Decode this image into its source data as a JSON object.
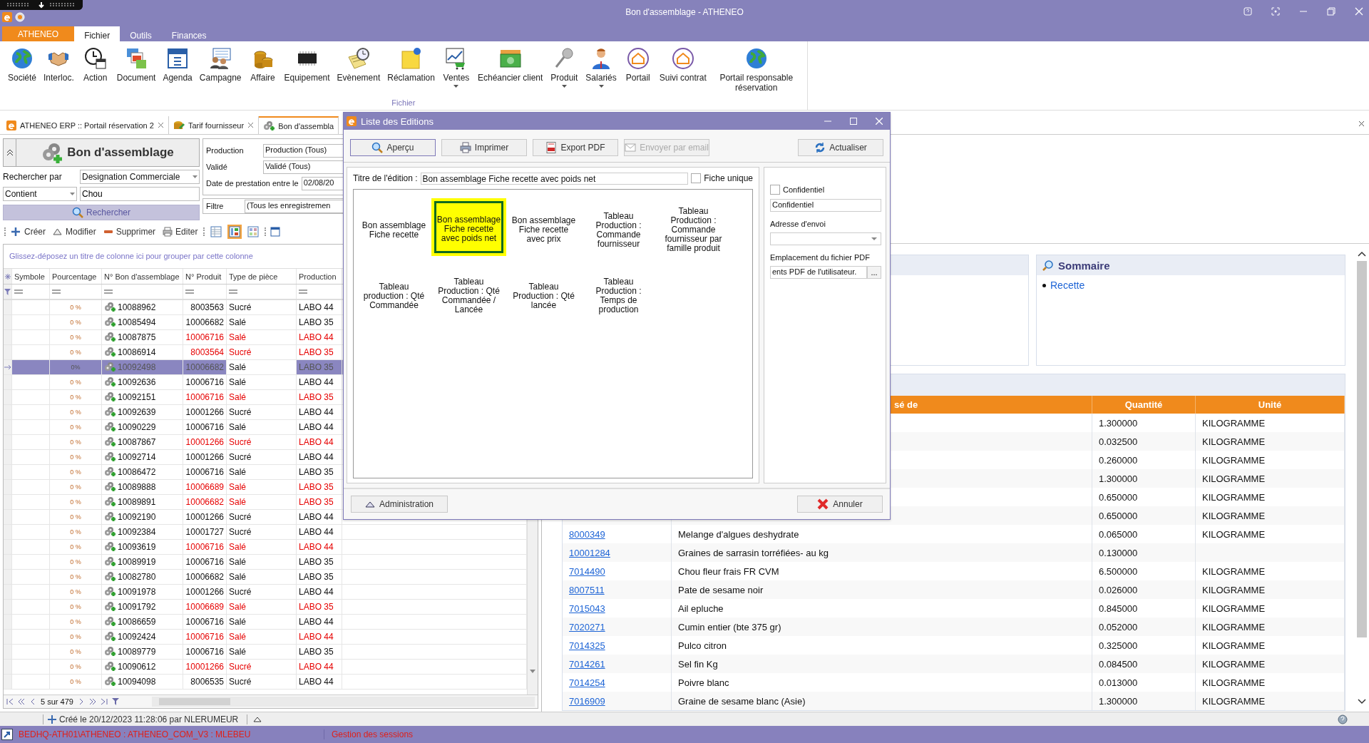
{
  "window": {
    "title": "Bon d'assemblage - ATHENEO"
  },
  "ribbon_tabs": [
    {
      "label": "ATHENEO",
      "kind": "app",
      "selected": false
    },
    {
      "label": "Fichier",
      "kind": "tab",
      "selected": true
    },
    {
      "label": "Outils",
      "kind": "tab",
      "selected": false
    },
    {
      "label": "Finances",
      "kind": "tab",
      "selected": false
    }
  ],
  "ribbon": {
    "group": "Fichier",
    "items": [
      {
        "label": "Société",
        "dropdown": false
      },
      {
        "label": "Interloc.",
        "dropdown": false
      },
      {
        "label": "Action",
        "dropdown": false
      },
      {
        "label": "Document",
        "dropdown": false
      },
      {
        "label": "Agenda",
        "dropdown": false
      },
      {
        "label": "Campagne",
        "dropdown": false
      },
      {
        "label": "Affaire",
        "dropdown": false
      },
      {
        "label": "Equipement",
        "dropdown": false
      },
      {
        "label": "Evènement",
        "dropdown": false
      },
      {
        "label": "Réclamation",
        "dropdown": false
      },
      {
        "label": "Ventes",
        "dropdown": true
      },
      {
        "label": "Echéancier client",
        "dropdown": false
      },
      {
        "label": "Produit",
        "dropdown": true
      },
      {
        "label": "Salariés",
        "dropdown": true
      },
      {
        "label": "Portail",
        "dropdown": false
      },
      {
        "label": "Suivi contrat",
        "dropdown": false
      },
      {
        "label": "Portail responsable réservation",
        "dropdown": false
      }
    ]
  },
  "document_tabs": [
    {
      "label": "ATHENEO ERP :: Portail réservation 2",
      "selected": false,
      "closable": true
    },
    {
      "label": "Tarif fournisseur",
      "selected": false,
      "closable": true
    },
    {
      "label": "Bon d'assembla",
      "selected": true,
      "closable": false
    }
  ],
  "search_panel": {
    "title": "Bon d'assemblage",
    "search_by_label": "Rechercher par",
    "search_by": "Designation Commerciale",
    "operator": "Contient",
    "query": "Chou",
    "button": "Rechercher"
  },
  "filter_panel": {
    "fields": [
      {
        "label": "Production",
        "value": "Production (Tous)"
      },
      {
        "label": "Validé",
        "value": "Validé (Tous)"
      },
      {
        "label": "Date de prestation entre le",
        "value": "02/08/20"
      }
    ],
    "filter_label": "Filtre",
    "filter_value": "(Tous les enregistremen"
  },
  "toolbar": {
    "actions": [
      "Créer",
      "Modifier",
      "Supprimer",
      "Editer"
    ],
    "views": [
      {
        "selected": false
      },
      {
        "selected": true
      },
      {
        "selected": false
      }
    ]
  },
  "grid": {
    "group_hint": "Glissez-déposez un titre de colonne ici pour grouper par cette colonne",
    "columns": [
      "Symbole",
      "Pourcentage",
      "N° Bon d'assemblage",
      "N° Produit",
      "Type de pièce",
      "Production"
    ],
    "rows": [
      {
        "percent": "0 %",
        "number": "10088962",
        "product": "8003563",
        "type": "Sucré",
        "production": "LABO 44",
        "flagged": false,
        "selected": false
      },
      {
        "percent": "0 %",
        "number": "10085494",
        "product": "10006682",
        "type": "Salé",
        "production": "LABO 35",
        "flagged": false,
        "selected": false
      },
      {
        "percent": "0 %",
        "number": "10087875",
        "product": "10006716",
        "type": "Salé",
        "production": "LABO 44",
        "flagged": true,
        "selected": false
      },
      {
        "percent": "0 %",
        "number": "10086914",
        "product": "8003564",
        "type": "Sucré",
        "production": "LABO 35",
        "flagged": true,
        "selected": false
      },
      {
        "percent": "0%",
        "number": "10092498",
        "product": "10006682",
        "type": "Salé",
        "production": "LABO 35",
        "flagged": false,
        "selected": true
      },
      {
        "percent": "0 %",
        "number": "10092636",
        "product": "10006716",
        "type": "Salé",
        "production": "LABO 44",
        "flagged": false,
        "selected": false
      },
      {
        "percent": "0 %",
        "number": "10092151",
        "product": "10006716",
        "type": "Salé",
        "production": "LABO 35",
        "flagged": true,
        "selected": false
      },
      {
        "percent": "0 %",
        "number": "10092639",
        "product": "10001266",
        "type": "Sucré",
        "production": "LABO 44",
        "flagged": false,
        "selected": false
      },
      {
        "percent": "0 %",
        "number": "10090229",
        "product": "10006716",
        "type": "Salé",
        "production": "LABO 44",
        "flagged": false,
        "selected": false
      },
      {
        "percent": "0 %",
        "number": "10087867",
        "product": "10001266",
        "type": "Sucré",
        "production": "LABO 44",
        "flagged": true,
        "selected": false
      },
      {
        "percent": "0 %",
        "number": "10092714",
        "product": "10001266",
        "type": "Sucré",
        "production": "LABO 44",
        "flagged": false,
        "selected": false
      },
      {
        "percent": "0 %",
        "number": "10086472",
        "product": "10006716",
        "type": "Salé",
        "production": "LABO 35",
        "flagged": false,
        "selected": false
      },
      {
        "percent": "0 %",
        "number": "10089888",
        "product": "10006689",
        "type": "Salé",
        "production": "LABO 35",
        "flagged": true,
        "selected": false
      },
      {
        "percent": "0 %",
        "number": "10089891",
        "product": "10006682",
        "type": "Salé",
        "production": "LABO 35",
        "flagged": true,
        "selected": false
      },
      {
        "percent": "0 %",
        "number": "10092190",
        "product": "10001266",
        "type": "Sucré",
        "production": "LABO 44",
        "flagged": false,
        "selected": false
      },
      {
        "percent": "0 %",
        "number": "10092384",
        "product": "10001727",
        "type": "Sucré",
        "production": "LABO 44",
        "flagged": false,
        "selected": false
      },
      {
        "percent": "0 %",
        "number": "10093619",
        "product": "10006716",
        "type": "Salé",
        "production": "LABO 44",
        "flagged": true,
        "selected": false
      },
      {
        "percent": "0 %",
        "number": "10089919",
        "product": "10006716",
        "type": "Salé",
        "production": "LABO 35",
        "flagged": false,
        "selected": false
      },
      {
        "percent": "0 %",
        "number": "10082780",
        "product": "10006682",
        "type": "Salé",
        "production": "LABO 35",
        "flagged": false,
        "selected": false
      },
      {
        "percent": "0 %",
        "number": "10091978",
        "product": "10001266",
        "type": "Sucré",
        "production": "LABO 44",
        "flagged": false,
        "selected": false
      },
      {
        "percent": "0 %",
        "number": "10091792",
        "product": "10006689",
        "type": "Salé",
        "production": "LABO 35",
        "flagged": true,
        "selected": false
      },
      {
        "percent": "0 %",
        "number": "10086659",
        "product": "10006716",
        "type": "Salé",
        "production": "LABO 44",
        "flagged": false,
        "selected": false
      },
      {
        "percent": "0 %",
        "number": "10092424",
        "product": "10006716",
        "type": "Salé",
        "production": "LABO 44",
        "flagged": true,
        "selected": false
      },
      {
        "percent": "0 %",
        "number": "10089779",
        "product": "10006716",
        "type": "Salé",
        "production": "LABO 35",
        "flagged": false,
        "selected": false
      },
      {
        "percent": "0 %",
        "number": "10090612",
        "product": "10001266",
        "type": "Sucré",
        "production": "LABO 44",
        "flagged": true,
        "selected": false
      },
      {
        "percent": "0 %",
        "number": "10094098",
        "product": "8006535",
        "type": "Sucré",
        "production": "LABO 44",
        "flagged": false,
        "selected": false
      }
    ],
    "pager": "5 sur 479"
  },
  "status": {
    "created": "Créé le 20/12/2023 11:28:06 par NLERUMEUR"
  },
  "session_bar": {
    "connection": "BEDHQ-ATH01\\ATHENEO : ATHENEO_COM_V3 : MLEBEU",
    "sessions": "Gestion des sessions"
  },
  "detail": {
    "summary_title": "Sommaire",
    "summary_links": [
      "Recette"
    ],
    "columns": [
      "sé de",
      "Quantité",
      "Unité"
    ],
    "rows": [
      {
        "quantity": "1.300000",
        "unit": "KILOGRAMME"
      },
      {
        "quantity": "0.032500",
        "unit": "KILOGRAMME"
      },
      {
        "quantity": "0.260000",
        "unit": "KILOGRAMME"
      },
      {
        "quantity": "1.300000",
        "unit": "KILOGRAMME"
      },
      {
        "quantity": "0.650000",
        "unit": "KILOGRAMME"
      },
      {
        "quantity": "0.650000",
        "unit": "KILOGRAMME"
      },
      {
        "code": "8000349",
        "description": "Melange d'algues deshydrate",
        "quantity": "0.065000",
        "unit": "KILOGRAMME"
      },
      {
        "code": "10001284",
        "description": "Graines de sarrasin torréfiées- au kg",
        "quantity": "0.130000"
      },
      {
        "code": "7014490",
        "description": "Chou fleur frais FR CVM",
        "quantity": "6.500000",
        "unit": "KILOGRAMME"
      },
      {
        "code": "8007511",
        "description": "Pate de sesame noir",
        "quantity": "0.026000",
        "unit": "KILOGRAMME"
      },
      {
        "code": "7015043",
        "description": "Ail epluche",
        "quantity": "0.845000",
        "unit": "KILOGRAMME"
      },
      {
        "code": "7020271",
        "description": "Cumin entier (bte 375 gr)",
        "quantity": "0.052000",
        "unit": "KILOGRAMME"
      },
      {
        "code": "7014325",
        "description": "Pulco citron",
        "quantity": "0.325000",
        "unit": "KILOGRAMME"
      },
      {
        "code": "7014261",
        "description": "Sel fin Kg",
        "quantity": "0.084500",
        "unit": "KILOGRAMME"
      },
      {
        "code": "7014254",
        "description": "Poivre blanc",
        "quantity": "0.013000",
        "unit": "KILOGRAMME"
      },
      {
        "code": "7016909",
        "description": "Graine de sesame blanc (Asie)",
        "quantity": "1.300000",
        "unit": "KILOGRAMME"
      }
    ]
  },
  "dialog": {
    "title": "Liste des Editions",
    "buttons": [
      {
        "label": "Aperçu",
        "kind": "preview",
        "disabled": false,
        "selected": true
      },
      {
        "label": "Imprimer",
        "kind": "print",
        "disabled": false,
        "selected": false
      },
      {
        "label": "Export PDF",
        "kind": "pdf",
        "disabled": false,
        "selected": false
      },
      {
        "label": "Envoyer par email",
        "kind": "email",
        "disabled": true,
        "selected": false
      }
    ],
    "refresh": "Actualiser",
    "title_label": "Titre de l'édition :",
    "title_value": "Bon assemblage Fiche recette avec poids net",
    "single_label": "Fiche unique",
    "single_checked": false,
    "reports": [
      {
        "label": "Bon assemblage Fiche recette",
        "selected": false
      },
      {
        "label": "Bon assemblage Fiche recette avec poids net",
        "selected": true
      },
      {
        "label": "Bon assemblage Fiche recette avec prix",
        "selected": false
      },
      {
        "label": "Tableau Production : Commande fournisseur",
        "selected": false
      },
      {
        "label": "Tableau Production : Commande fournisseur par famille produit",
        "selected": false
      },
      {
        "label": "Tableau production : Qté Commandée",
        "selected": false
      },
      {
        "label": "Tableau Production : Qté Commandée / Lancée",
        "selected": false
      },
      {
        "label": "Tableau Production : Qté lancée",
        "selected": false
      },
      {
        "label": "Tableau Production : Temps de production",
        "selected": false
      }
    ],
    "confidential_label": "Confidentiel",
    "confidential_checked": false,
    "confidential_value": "Confidentiel",
    "address_label": "Adresse d'envoi",
    "pdf_label": "Emplacement du fichier PDF",
    "pdf_value": "ents PDF de l'utilisateur.",
    "browse": "...",
    "admin": "Administration",
    "cancel": "Annuler"
  }
}
